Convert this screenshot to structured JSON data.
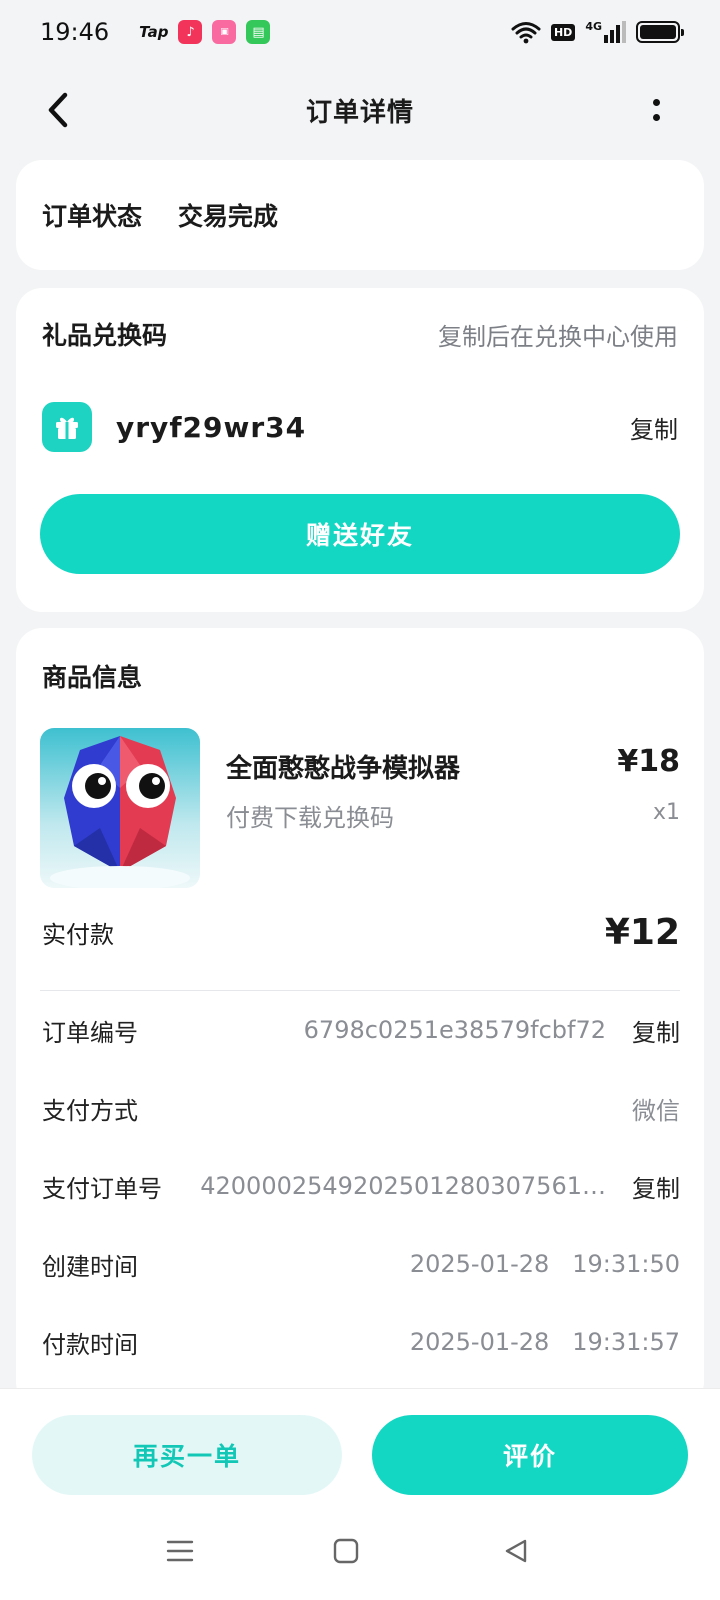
{
  "status_bar": {
    "time": "19:46",
    "apps": [
      "Tap",
      "music-app-icon",
      "bilibili-app-icon",
      "messages-app-icon"
    ],
    "hd_label": "HD",
    "network_label": "4G"
  },
  "nav": {
    "title": "订单详情"
  },
  "order_status": {
    "label": "订单状态",
    "value": "交易完成"
  },
  "gift_code": {
    "title": "礼品兑换码",
    "hint": "复制后在兑换中心使用",
    "code": "yryf29wr34",
    "copy_label": "复制",
    "send_button": "赠送好友"
  },
  "product_info": {
    "title": "商品信息",
    "name": "全面憨憨战争模拟器",
    "subtitle": "付费下载兑换码",
    "price": "¥18",
    "quantity": "x1",
    "paid_label": "实付款",
    "paid_value": "¥12",
    "rows": [
      {
        "label": "订单编号",
        "value": "6798c0251e38579fcbf72",
        "copy": "复制"
      },
      {
        "label": "支付方式",
        "value": "微信",
        "copy": ""
      },
      {
        "label": "支付订单号",
        "value": "4200002549202501280307561…",
        "copy": "复制"
      },
      {
        "label": "创建时间",
        "value": "2025-01-28   19:31:50",
        "copy": ""
      },
      {
        "label": "付款时间",
        "value": "2025-01-28   19:31:57",
        "copy": ""
      }
    ]
  },
  "actions": {
    "rebuy": "再买一单",
    "review": "评价"
  },
  "colors": {
    "accent": "#13d6c3",
    "accent_light": "#e3f8f6",
    "muted_text": "#8a8d93"
  }
}
